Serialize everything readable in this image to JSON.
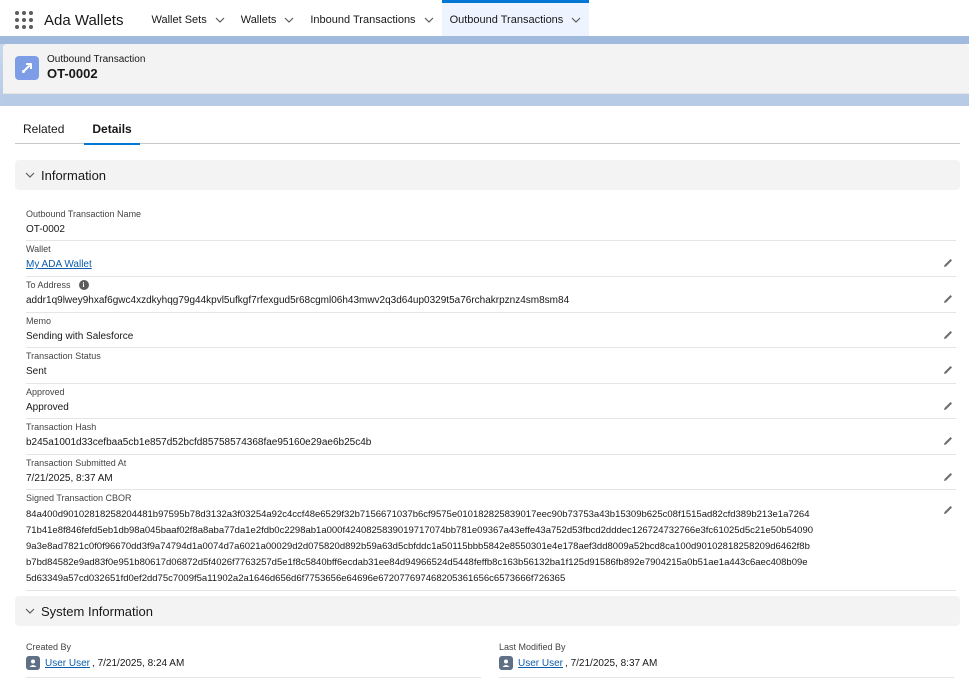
{
  "nav": {
    "app_name": "Ada Wallets",
    "tabs": [
      {
        "label": "Wallet Sets"
      },
      {
        "label": "Wallets"
      },
      {
        "label": "Inbound Transactions"
      },
      {
        "label": "Outbound Transactions"
      }
    ]
  },
  "header": {
    "object_label": "Outbound Transaction",
    "record_name": "OT-0002"
  },
  "tabs": {
    "related": "Related",
    "details": "Details"
  },
  "sections": {
    "information": "Information",
    "system_information": "System Information"
  },
  "fields": {
    "name": {
      "label": "Outbound Transaction Name",
      "value": "OT-0002"
    },
    "wallet": {
      "label": "Wallet",
      "value": "My ADA Wallet"
    },
    "to_address": {
      "label": "To Address",
      "value": "addr1q9lwey9hxaf6gwc4xzdkyhqg79g44kpvl5ufkgf7rfexgud5r68cgml06h43mwv2q3d64up0329t5a76rchakrpznz4sm8sm84"
    },
    "memo": {
      "label": "Memo",
      "value": "Sending with Salesforce"
    },
    "status": {
      "label": "Transaction Status",
      "value": "Sent"
    },
    "approved": {
      "label": "Approved",
      "value": "Approved"
    },
    "hash": {
      "label": "Transaction Hash",
      "value": "b245a1001d33cefbaa5cb1e857d52bcfd85758574368fae95160e29ae6b25c4b"
    },
    "submitted_at": {
      "label": "Transaction Submitted At",
      "value": "7/21/2025, 8:37 AM"
    },
    "cbor": {
      "label": "Signed Transaction CBOR",
      "lines": [
        "84a400d90102818258204481b97595b78d3132a3f03254a92c4ccf48e6529f32b7156671037b6cf9575e010182825839017eec90b73753a43b15309b625c08f1515ad82cfd389b213e1a7264",
        "71b41e8f846fefd5eb1db98a045baaf02f8a8aba77da1e2fdb0c2298ab1a000f4240825839019717074bb781e09367a43effe43a752d53fbcd2dddec126724732766e3fc61025d5c21e50b54090",
        "9a3e8ad7821c0f0f96670dd3f9a74794d1a0074d7a6021a00029d2d075820d892b59a63d5cbfddc1a50115bbb5842e8550301e4e178aef3dd8009a52bcd8ca100d90102818258209d6462f8b",
        "b7bd84582e9ad83f0e951b80617d06872d5f4026f7763257d5e1f8c5840bff6ecdab31ee84d94966524d5448feffb8c163b56132ba1f125d91586fb892e7904215a0b51ae1a443c6aec408b09e",
        "5d63349a57cd032651fd0ef2dd75c7009f5a11902a2a1646d656d6f7753656e64696e672077697468205361656c6573666f726365"
      ]
    }
  },
  "system": {
    "created_by": {
      "label": "Created By",
      "user": "User User",
      "timestamp": ", 7/21/2025, 8:24 AM"
    },
    "last_modified_by": {
      "label": "Last Modified By",
      "user": "User User",
      "timestamp": ", 7/21/2025, 8:37 AM"
    }
  },
  "colors": {
    "brand_blue": "#0176d3",
    "link": "#0b5cab",
    "object_icon": "#7d9ee6"
  },
  "icons": [
    "app-launcher-icon",
    "chevron-down-icon",
    "outbound-transaction-icon",
    "pencil-icon",
    "info-icon",
    "user-avatar-icon"
  ]
}
